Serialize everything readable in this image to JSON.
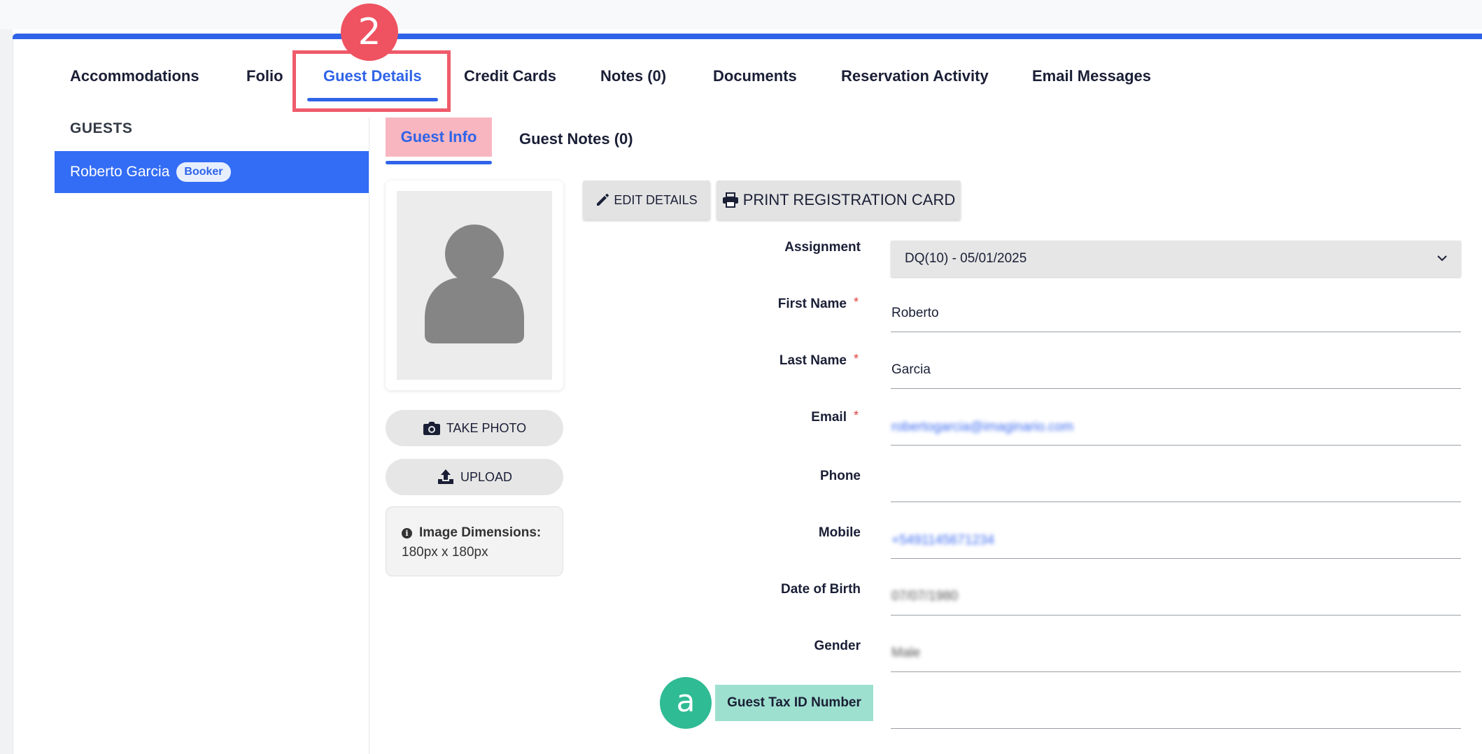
{
  "main_tabs": [
    {
      "label": "Accommodations"
    },
    {
      "label": "Folio"
    },
    {
      "label": "Guest Details"
    },
    {
      "label": "Credit Cards"
    },
    {
      "label": "Notes (0)"
    },
    {
      "label": "Documents"
    },
    {
      "label": "Reservation Activity"
    },
    {
      "label": "Email Messages"
    }
  ],
  "active_main_tab": "Guest Details",
  "annotations": {
    "step_badge": "2",
    "field_badge": "a"
  },
  "guests": {
    "title": "GUESTS",
    "items": [
      {
        "name": "Roberto Garcia",
        "badge": "Booker"
      }
    ]
  },
  "sub_tabs": [
    {
      "label": "Guest Info"
    },
    {
      "label": "Guest Notes (0)"
    }
  ],
  "photo": {
    "take_photo_label": "TAKE PHOTO",
    "upload_label": "UPLOAD",
    "dimensions_label": "Image Dimensions:",
    "dimensions_value": "180px x 180px"
  },
  "actions": {
    "edit_label": "EDIT DETAILS",
    "print_label": "PRINT REGISTRATION CARD"
  },
  "form": {
    "assignment": {
      "label": "Assignment",
      "value": "DQ(10) - 05/01/2025"
    },
    "first_name": {
      "label": "First Name",
      "value": "Roberto",
      "required": true
    },
    "last_name": {
      "label": "Last Name",
      "value": "Garcia",
      "required": true
    },
    "email": {
      "label": "Email",
      "value": "robertogarcia@imaginario.com",
      "required": true
    },
    "phone": {
      "label": "Phone",
      "value": ""
    },
    "mobile": {
      "label": "Mobile",
      "value": "+5491145671234"
    },
    "dob": {
      "label": "Date of Birth",
      "value": "07/07/1980"
    },
    "gender": {
      "label": "Gender",
      "value": "Male"
    },
    "tax_id": {
      "label": "Guest Tax ID Number",
      "value": ""
    },
    "required_marker": "*"
  },
  "colors": {
    "accent": "#2f63e8",
    "highlight_red": "#ef5b6b",
    "highlight_green": "#9ee0cf",
    "badge_green": "#2fbb94",
    "selected_row": "#336cf5"
  }
}
